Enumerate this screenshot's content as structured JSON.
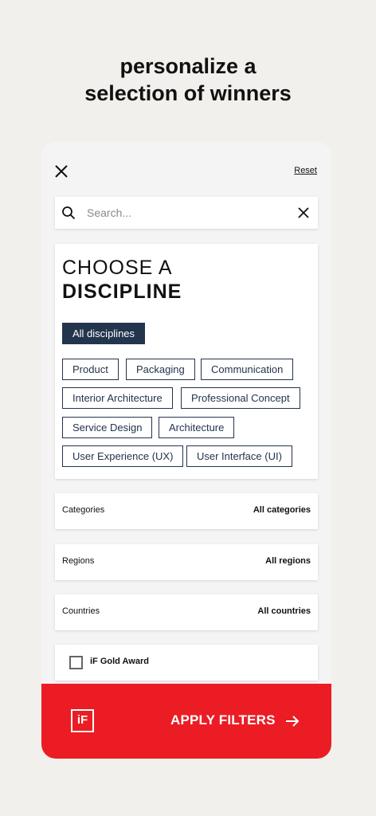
{
  "headline": {
    "line1": "personalize a",
    "line2": "selection of winners"
  },
  "panel": {
    "reset_label": "Reset",
    "search": {
      "placeholder": "Search...",
      "value": ""
    },
    "discipline": {
      "title_line1": "CHOOSE A",
      "title_line2": "DISCIPLINE",
      "chips": [
        {
          "label": "All disciplines",
          "selected": true
        },
        {
          "label": "Product",
          "selected": false
        },
        {
          "label": "Packaging",
          "selected": false
        },
        {
          "label": "Communication",
          "selected": false
        },
        {
          "label": "Interior Architecture",
          "selected": false
        },
        {
          "label": "Professional Concept",
          "selected": false
        },
        {
          "label": "Service Design",
          "selected": false
        },
        {
          "label": "Architecture",
          "selected": false
        },
        {
          "label": "User Experience (UX)",
          "selected": false
        },
        {
          "label": "User Interface (UI)",
          "selected": false
        }
      ]
    },
    "filters": [
      {
        "label": "Categories",
        "value": "All categories"
      },
      {
        "label": "Regions",
        "value": "All regions"
      },
      {
        "label": "Countries",
        "value": "All countries"
      }
    ],
    "gold_award": {
      "label": "iF Gold Award",
      "checked": false
    },
    "apply": {
      "logo_text": "iF",
      "label": "APPLY FILTERS"
    }
  },
  "colors": {
    "background": "#f2f0ec",
    "accent_red": "#ec1c24",
    "navy": "#23344d"
  },
  "icons": [
    "close-icon",
    "search-icon",
    "clear-icon",
    "arrow-right-icon",
    "if-logo-icon"
  ]
}
